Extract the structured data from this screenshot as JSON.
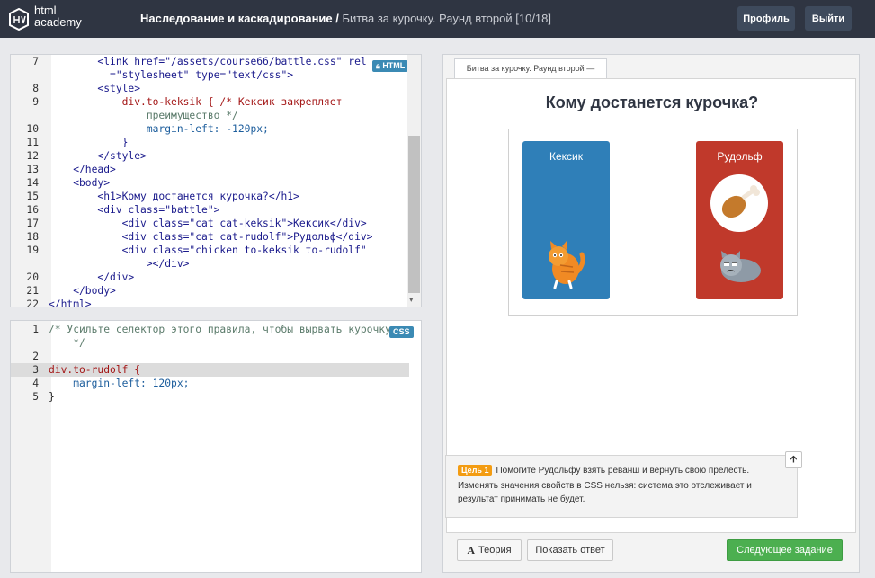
{
  "app": {
    "logo_line1": "html",
    "logo_line2": "academy"
  },
  "breadcrumb": {
    "section": "Наследование и каскадирование /",
    "page": "Битва за курочку. Раунд второй",
    "progress": "[10/18]"
  },
  "header_buttons": {
    "profile": "Профиль",
    "logout": "Выйти"
  },
  "html_editor": {
    "badge": "HTML",
    "lines": [
      {
        "n": "7",
        "text": "        <link href=\"/assets/course66/battle.css\" rel"
      },
      {
        "n": "",
        "text": "          =\"stylesheet\" type=\"text/css\">"
      },
      {
        "n": "8",
        "text": "        <style>"
      },
      {
        "n": "9",
        "text": "            div.to-keksik { /* Кексик закрепляет"
      },
      {
        "n": "",
        "text": "                преимущество */"
      },
      {
        "n": "10",
        "text": "                margin-left: -120px;"
      },
      {
        "n": "11",
        "text": "            }"
      },
      {
        "n": "12",
        "text": "        </style>"
      },
      {
        "n": "13",
        "text": "    </head>"
      },
      {
        "n": "14",
        "text": "    <body>"
      },
      {
        "n": "15",
        "text": "        <h1>Кому достанется курочка?</h1>"
      },
      {
        "n": "16",
        "text": "        <div class=\"battle\">"
      },
      {
        "n": "17",
        "text": "            <div class=\"cat cat-keksik\">Кексик</div>"
      },
      {
        "n": "18",
        "text": "            <div class=\"cat cat-rudolf\">Рудольф</div>"
      },
      {
        "n": "19",
        "text": "            <div class=\"chicken to-keksik to-rudolf\""
      },
      {
        "n": "",
        "text": "                ></div>"
      },
      {
        "n": "20",
        "text": "        </div>"
      },
      {
        "n": "21",
        "text": "    </body>"
      },
      {
        "n": "22",
        "text": "</html>"
      }
    ]
  },
  "css_editor": {
    "badge": "CSS",
    "lines": [
      {
        "n": "1",
        "text": "/* Усильте селектор этого правила, чтобы вырвать курочку"
      },
      {
        "n": "",
        "text": "    */"
      },
      {
        "n": "2",
        "text": ""
      },
      {
        "n": "3",
        "text": "div.to-rudolf {"
      },
      {
        "n": "4",
        "text": "    margin-left: 120px;"
      },
      {
        "n": "5",
        "text": "}"
      }
    ]
  },
  "preview": {
    "tab_title": "Битва за курочку. Раунд второй —",
    "heading": "Кому достанется курочка?",
    "cat_left": "Кексик",
    "cat_right": "Рудольф",
    "colors": {
      "left": "#2f7fb8",
      "right": "#c0392b"
    }
  },
  "goal": {
    "label": "Цель 1",
    "text1": "Помогите Рудольфу взять реванш и вернуть свою прелесть.",
    "text2": "Изменять значения свойств в CSS нельзя: система это отслеживает и",
    "text3": "результат принимать не будет."
  },
  "footer_buttons": {
    "theory": "Теория",
    "show_answer": "Показать ответ",
    "next": "Следующее задание"
  }
}
